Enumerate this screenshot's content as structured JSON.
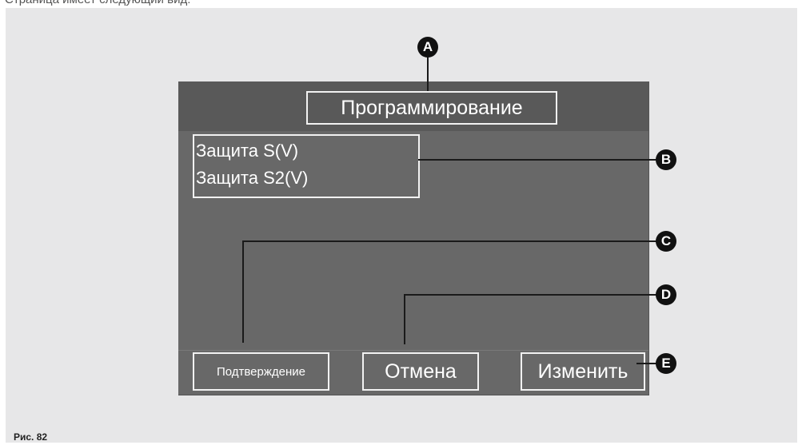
{
  "caption_top": "Страница имеет следующий вид:",
  "figure_caption": "Рис. 82",
  "screen": {
    "title": "Программирование",
    "menu_items": [
      "Защита S(V)",
      "Защита S2(V)"
    ],
    "buttons": {
      "confirm": "Подтверждение",
      "cancel": "Отмена",
      "change": "Изменить"
    }
  },
  "callouts": {
    "a": "A",
    "b": "B",
    "c": "C",
    "d": "D",
    "e": "E"
  },
  "colors": {
    "panel_background": "#e7e7e8",
    "screen_background": "#686868",
    "header_background": "#595959",
    "frame": "#f2f2f2",
    "marker": "#111111"
  }
}
